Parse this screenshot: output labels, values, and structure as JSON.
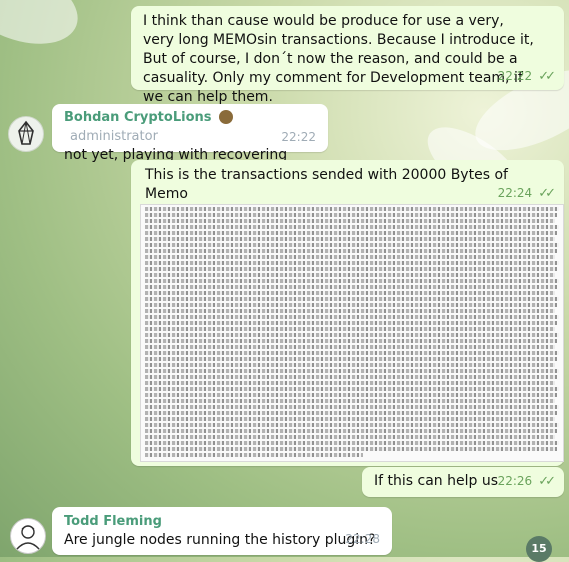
{
  "messages": [
    {
      "text": "I think than cause would be produce for use a very, very long MEMOsin transactions. Because I introduce it, But of course, I don´t now the reason, and could be a casuality. Only my comment for Development team, if we can help them.",
      "time": "22:22"
    },
    {
      "sender": "Bohdan CryptoLions",
      "role": "administrator",
      "text": "not yet, playing with recovering",
      "time": "22:22"
    },
    {
      "text": "This is the transactions sended with 20000 Bytes of Memo",
      "time": "22:24"
    },
    {
      "text": "If this can help us",
      "time": "22:26"
    },
    {
      "sender": "Todd Fleming",
      "text": "Are jungle nodes running the history plugin?",
      "time": "22:28"
    }
  ],
  "read_ticks": "✓✓",
  "unread_count": "15",
  "icons": {
    "eos_avatar": "eos-logo-avatar",
    "owl_emoji": "owl-emoji-icon",
    "todd_avatar": "sketch-avatar"
  },
  "colors": {
    "outgoing_bubble": "#effdde",
    "incoming_bubble": "#ffffff",
    "sender_name": "#4a9c7a",
    "time_out": "#6aa35c"
  }
}
